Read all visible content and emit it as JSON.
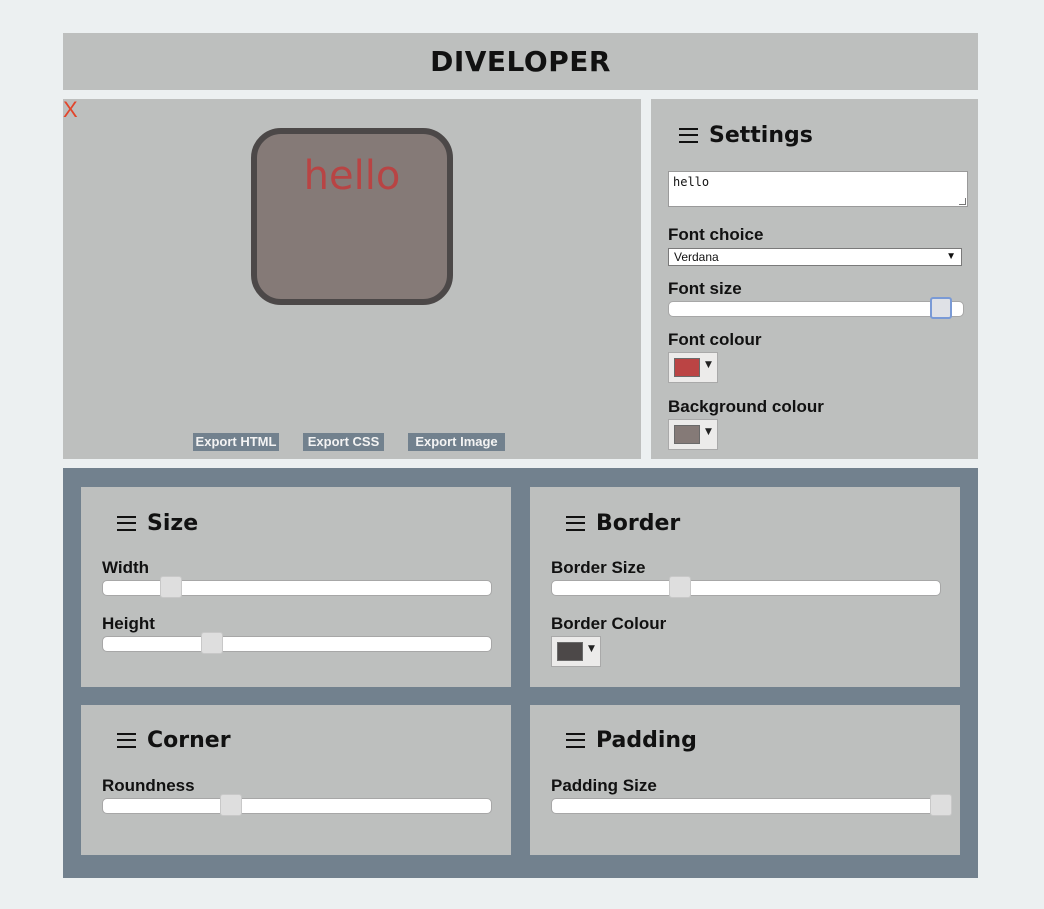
{
  "app": {
    "title": "DIVELOPER"
  },
  "preview": {
    "close_label": "X",
    "text": "hello",
    "exports": [
      {
        "label": "Export HTML"
      },
      {
        "label": "Export CSS"
      },
      {
        "label": "Export Image"
      }
    ]
  },
  "settings": {
    "title": "Settings",
    "text_value": "hello",
    "font_choice": {
      "label": "Font choice",
      "value": "Verdana"
    },
    "font_size": {
      "label": "Font size",
      "level": 0.92
    },
    "font_colour": {
      "label": "Font colour",
      "value": "#bb4444"
    },
    "background_colour": {
      "label": "Background colour",
      "value": "#857a77"
    }
  },
  "size": {
    "title": "Size",
    "width": {
      "label": "Width",
      "level": 0.15
    },
    "height": {
      "label": "Height",
      "level": 0.26
    }
  },
  "border": {
    "title": "Border",
    "border_size": {
      "label": "Border Size",
      "level": 0.31
    },
    "border_colour": {
      "label": "Border Colour",
      "value": "#4c4848"
    }
  },
  "corner": {
    "title": "Corner",
    "roundness": {
      "label": "Roundness",
      "level": 0.31
    }
  },
  "padding": {
    "title": "Padding",
    "padding_size": {
      "label": "Padding Size",
      "level": 1.0
    }
  },
  "colors": {
    "page_background": "#ecf0f1",
    "panel": "#bdbfbe",
    "controls_background": "#72818e",
    "close_red": "#e2452b"
  },
  "icons": {
    "menu": "hamburger-menu-icon",
    "close": "close-icon",
    "dropdown": "chevron-down-icon"
  }
}
